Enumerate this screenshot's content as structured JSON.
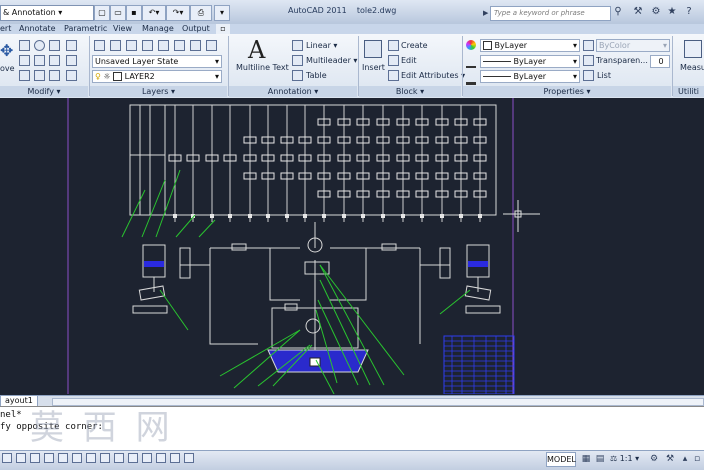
{
  "titlebar": {
    "workspace": "& Annotation",
    "app_title": "AutoCAD 2011",
    "file_name": "tole2.dwg",
    "search_placeholder": "Type a keyword or phrase"
  },
  "tabs": [
    "ert",
    "Annotate",
    "Parametric",
    "View",
    "Manage",
    "Output"
  ],
  "ribbon": {
    "modify": {
      "title": "Modify",
      "move_label": "ove"
    },
    "layers": {
      "title": "Layers",
      "layer_state": "Unsaved Layer State",
      "layer_name": "LAYER2"
    },
    "annotation": {
      "title": "Annotation",
      "big_letter": "A",
      "multiline_text": "Multiline Text",
      "linear": "Linear",
      "multileader": "Multileader",
      "table": "Table"
    },
    "block": {
      "title": "Block",
      "insert": "Insert",
      "create": "Create",
      "edit": "Edit",
      "edit_attributes": "Edit Attributes"
    },
    "properties": {
      "title": "Properties",
      "color": "ByLayer",
      "linetype": "ByLayer",
      "lineweight": "ByLayer",
      "plot_style": "ByColor",
      "transparency": "Transparen...",
      "transparency_value": "0",
      "list": "List"
    },
    "utilities": {
      "title": "Utiliti",
      "measure": "Measu"
    }
  },
  "layout_tab": "ayout1",
  "command_lines": [
    "nel*",
    "fy opposite corner:"
  ],
  "watermark": "莫 西 网",
  "status": {
    "model": "MODEL",
    "scale": "1:1"
  }
}
